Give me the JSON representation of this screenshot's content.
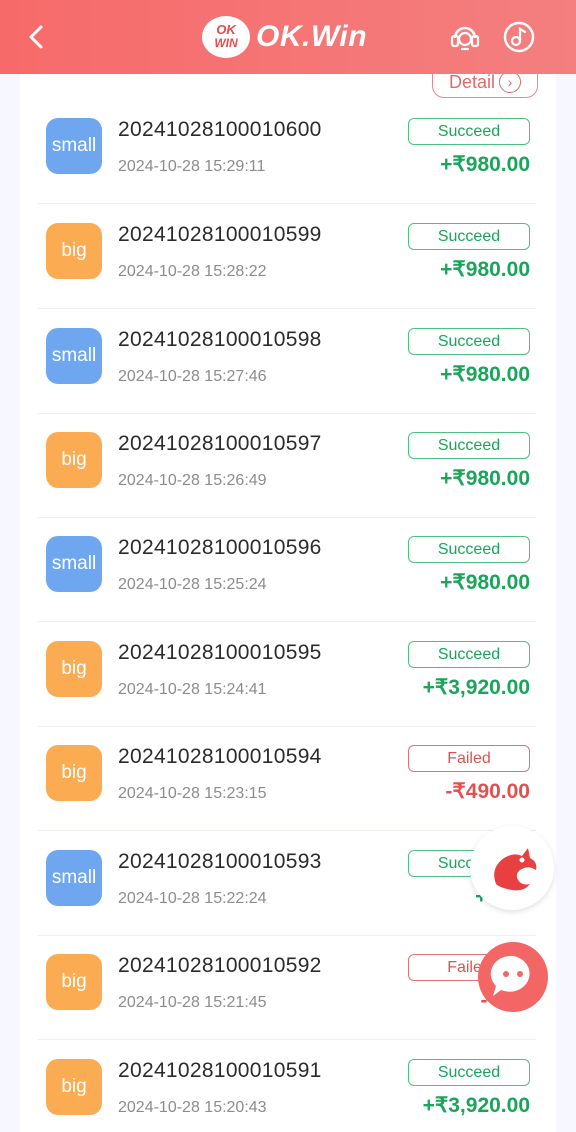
{
  "header": {
    "logo_badge_text_top": "OK",
    "logo_badge_text_bottom": "WIN",
    "logo_text": "OK.Win",
    "back_icon": "chevron-left-icon",
    "support_icon": "headset-support-icon",
    "music_icon": "music-note-icon"
  },
  "detail_button": {
    "label": "Detail"
  },
  "records": [
    {
      "type": "small",
      "order": "20241028100010600",
      "time": "2024-10-28 15:29:11",
      "status": "Succeed",
      "amount": "+₹980.00",
      "ok": true
    },
    {
      "type": "big",
      "order": "20241028100010599",
      "time": "2024-10-28 15:28:22",
      "status": "Succeed",
      "amount": "+₹980.00",
      "ok": true
    },
    {
      "type": "small",
      "order": "20241028100010598",
      "time": "2024-10-28 15:27:46",
      "status": "Succeed",
      "amount": "+₹980.00",
      "ok": true
    },
    {
      "type": "big",
      "order": "20241028100010597",
      "time": "2024-10-28 15:26:49",
      "status": "Succeed",
      "amount": "+₹980.00",
      "ok": true
    },
    {
      "type": "small",
      "order": "20241028100010596",
      "time": "2024-10-28 15:25:24",
      "status": "Succeed",
      "amount": "+₹980.00",
      "ok": true
    },
    {
      "type": "big",
      "order": "20241028100010595",
      "time": "2024-10-28 15:24:41",
      "status": "Succeed",
      "amount": "+₹3,920.00",
      "ok": true
    },
    {
      "type": "big",
      "order": "20241028100010594",
      "time": "2024-10-28 15:23:15",
      "status": "Failed",
      "amount": "-₹490.00",
      "ok": false
    },
    {
      "type": "small",
      "order": "20241028100010593",
      "time": "2024-10-28 15:22:24",
      "status": "Succeed",
      "amount": "+₹3,3",
      "ok": true
    },
    {
      "type": "big",
      "order": "20241028100010592",
      "time": "2024-10-28 15:21:45",
      "status": "Failed",
      "amount": "-₹1,3",
      "ok": false
    },
    {
      "type": "big",
      "order": "20241028100010591",
      "time": "2024-10-28 15:20:43",
      "status": "Succeed",
      "amount": "+₹3,920.00",
      "ok": true
    }
  ],
  "floating": {
    "dragon_icon": "dragon-icon",
    "chat_icon": "chat-bubble-icon"
  },
  "colors": {
    "header": "#f47070",
    "success": "#1aa55a",
    "fail": "#e05252",
    "small": "#6ea7f0",
    "big": "#fbac52"
  }
}
